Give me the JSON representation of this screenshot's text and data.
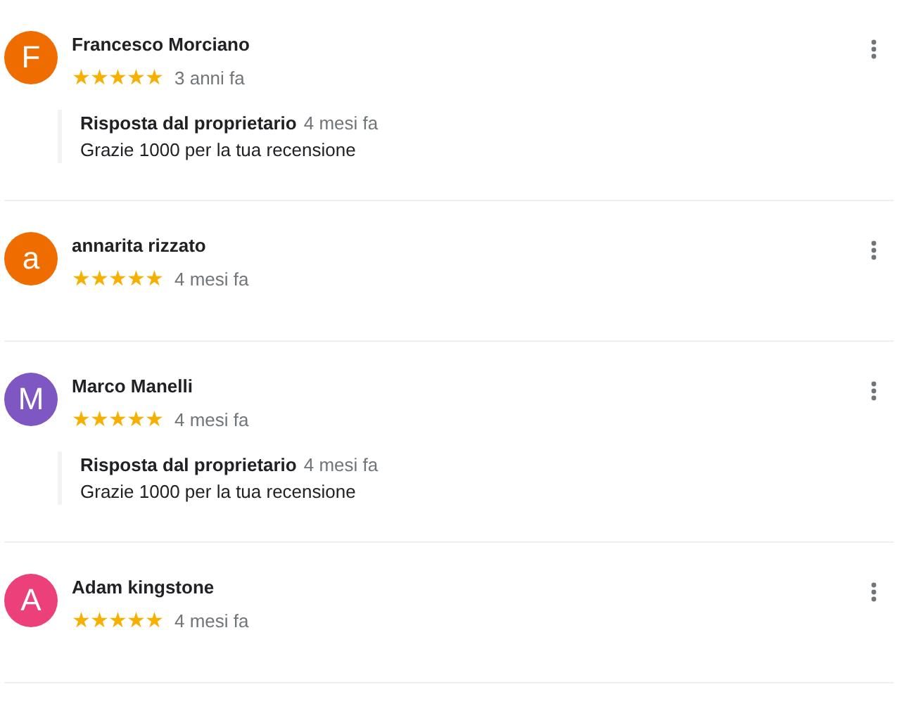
{
  "reviews": [
    {
      "initial": "F",
      "color": "#ef6c00",
      "name": "Francesco Morciano",
      "stars": 5,
      "time": "3 anni fa",
      "reply": {
        "label": "Risposta dal proprietario",
        "time": "4 mesi fa",
        "text": "Grazie 1000 per la tua recensione"
      }
    },
    {
      "initial": "a",
      "color": "#ef6c00",
      "name": "annarita rizzato",
      "stars": 5,
      "time": "4 mesi fa"
    },
    {
      "initial": "M",
      "color": "#7e57c2",
      "name": "Marco Manelli",
      "stars": 5,
      "time": "4 mesi fa",
      "reply": {
        "label": "Risposta dal proprietario",
        "time": "4 mesi fa",
        "text": "Grazie 1000 per la tua recensione"
      }
    },
    {
      "initial": "A",
      "color": "#ec407a",
      "name": "Adam kingstone",
      "stars": 5,
      "time": "4 mesi fa"
    }
  ]
}
